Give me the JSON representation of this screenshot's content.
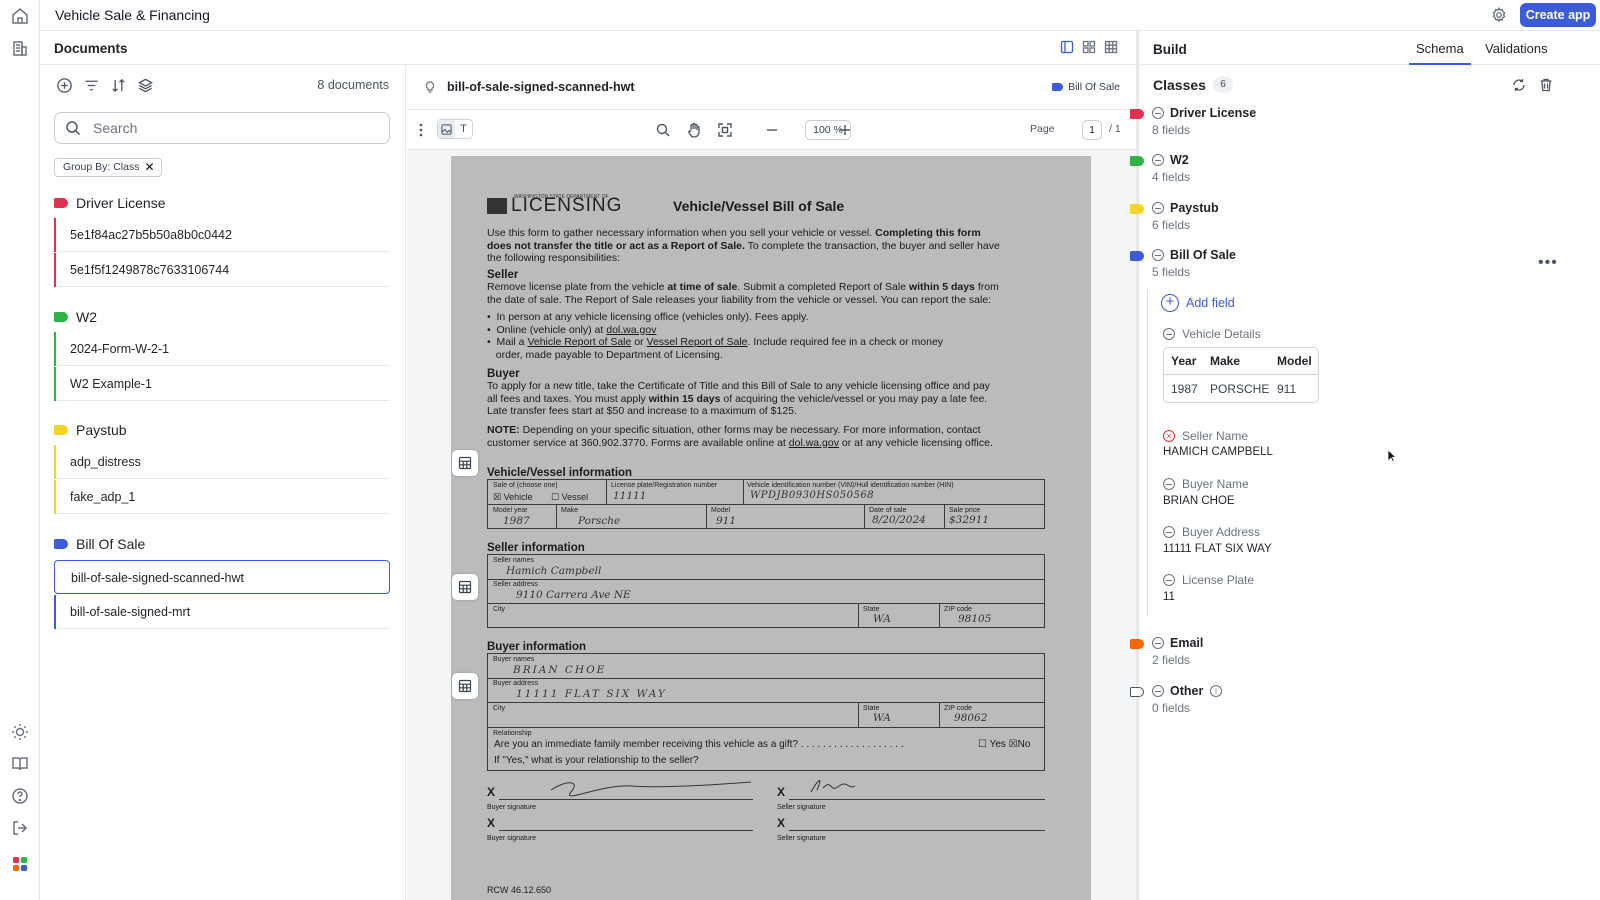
{
  "app": {
    "title": "Vehicle Sale & Financing",
    "create_app_label": "Create app"
  },
  "documents": {
    "title": "Documents",
    "count_label": "8 documents",
    "search_placeholder": "Search",
    "group_chip": "Group By: Class",
    "groups": [
      {
        "label": "Driver License",
        "color": "#e03150",
        "items": [
          "5e1f84ac27b5b50a8b0c0442",
          "5e1f5f1249878c7633106744"
        ]
      },
      {
        "label": "W2",
        "color": "#2fb344",
        "items": [
          "2024-Form-W-2-1",
          "W2 Example-1"
        ]
      },
      {
        "label": "Paystub",
        "color": "#f5d32a",
        "items": [
          "adp_distress",
          "fake_adp_1"
        ]
      },
      {
        "label": "Bill Of Sale",
        "color": "#3b5bdb",
        "items": [
          "bill-of-sale-signed-scanned-hwt",
          "bill-of-sale-signed-mrt"
        ]
      }
    ],
    "selected_item": "bill-of-sale-signed-scanned-hwt"
  },
  "viewer": {
    "file_name": "bill-of-sale-signed-scanned-hwt",
    "class_label": "Bill Of Sale",
    "zoom": "100 %",
    "page_label": "Page",
    "page_current": "1",
    "page_total": "/ 1"
  },
  "paper": {
    "dept_small": "WASHINGTON STATE DEPARTMENT OF",
    "dept_big": "LICENSING",
    "title": "Vehicle/Vessel Bill of Sale",
    "intro_1": "Use this form to gather necessary information when you sell your vehicle or vessel.",
    "intro_bold_1": "Completing this form",
    "intro_bold_2": "does not transfer the title or act as a Report of Sale.",
    "intro_2": "To complete the transaction, the buyer and seller have",
    "intro_3": "the following responsibilities:",
    "seller_head": "Seller",
    "seller_1a": "Remove license plate from the vehicle",
    "seller_1b": "at time of sale",
    "seller_1c": ". Submit a completed Report of Sale",
    "seller_1d": "within 5 days",
    "seller_1e": "from",
    "seller_2": "the date of sale. The Report of Sale releases your liability from the vehicle or vessel. You can report the sale:",
    "bullet_1": "In person at any vehicle licensing office (vehicles only). Fees apply.",
    "bullet_2a": "Online (vehicle only) at",
    "bullet_2b": "dol.wa.gov",
    "bullet_3a": "Mail a",
    "bullet_3b": "Vehicle Report of Sale",
    "bullet_3c": "or",
    "bullet_3d": "Vessel Report of Sale",
    "bullet_3e": ". Include required fee in a check or money",
    "bullet_3f": "order, made payable to Department of Licensing.",
    "buyer_head": "Buyer",
    "buyer_1": "To apply for a new title, take the Certificate of Title and this Bill of Sale to any vehicle licensing office and pay",
    "buyer_2a": "all fees and taxes. You must apply",
    "buyer_2b": "within 15 days",
    "buyer_2c": "of acquiring the vehicle/vessel or you may pay a late fee.",
    "buyer_3": "Late transfer fees start at $50 and increase to a maximum of $125.",
    "note_1a": "NOTE:",
    "note_1b": "Depending on your specific situation, other forms may be necessary. For more information, contact",
    "note_2a": "customer service at 360.902.3770. Forms are available online at",
    "note_2b": "dol.wa.gov",
    "note_2c": "or at any vehicle licensing office.",
    "vv_head": "Vehicle/Vessel information",
    "sale_of": "Sale of (choose one)",
    "opt_vehicle": "Vehicle",
    "opt_vessel": "Vessel",
    "plate_lbl": "License plate/Registration number",
    "vin_lbl": "Vehicle identification number (VIN)/Hull identification number (HIN)",
    "plate_val": "11111",
    "vin_val": "WPDJB0930HS050568",
    "model_year_lbl": "Model year",
    "make_lbl": "Make",
    "model_lbl": "Model",
    "date_lbl": "Date of sale",
    "price_lbl": "Sale price",
    "model_year_val": "1987",
    "make_val": "Porsche",
    "model_val": "911",
    "date_val": "8/20/2024",
    "price_val": "$32911",
    "seller_info_head": "Seller information",
    "seller_names_lbl": "Seller names",
    "seller_names_val": "Hamich Campbell",
    "seller_addr_lbl": "Seller address",
    "seller_addr_val": "9110 Carrera Ave NE",
    "city_lbl": "City",
    "state_lbl": "State",
    "zip_lbl": "ZIP code",
    "seller_state_val": "WA",
    "seller_zip_val": "98105",
    "buyer_info_head": "Buyer information",
    "buyer_names_lbl": "Buyer names",
    "buyer_names_val": "BRIAN CHOE",
    "buyer_addr_lbl": "Buyer address",
    "buyer_addr_val": "11111 FLAT SIX WAY",
    "buyer_state_val": "WA",
    "buyer_zip_val": "98062",
    "relationship_lbl": "Relationship",
    "family_q": "Are you an immediate family member receiving this vehicle as a gift? . . . . . . . . . . . . . . . . . . .",
    "yes_lbl": "Yes",
    "no_lbl": "No",
    "if_yes": "If \"Yes,\" what is your relationship to the seller?",
    "x_mark": "X",
    "buyer_sig": "Buyer signature",
    "seller_sig": "Seller signature",
    "footer_code": "RCW 46.12.650"
  },
  "build": {
    "title": "Build",
    "tabs": [
      "Schema",
      "Validations"
    ],
    "classes_label": "Classes",
    "classes_count": "6",
    "classes": [
      {
        "name": "Driver License",
        "sub": "8 fields",
        "color": "#e03150"
      },
      {
        "name": "W2",
        "sub": "4 fields",
        "color": "#2fb344"
      },
      {
        "name": "Paystub",
        "sub": "6 fields",
        "color": "#f5d32a"
      },
      {
        "name": "Bill Of Sale",
        "sub": "5 fields",
        "color": "#3b5bdb"
      },
      {
        "name": "Email",
        "sub": "2 fields",
        "color": "#f76707"
      },
      {
        "name": "Other",
        "sub": "0 fields",
        "color": "#ffffff"
      }
    ],
    "add_field": "Add field",
    "vehicle_details": {
      "label": "Vehicle Details",
      "columns": [
        "Year",
        "Make",
        "Model"
      ],
      "row": [
        "1987",
        "PORSCHE",
        "911"
      ]
    },
    "fields": [
      {
        "label": "Seller Name",
        "value": "HAMICH CAMPBELL"
      },
      {
        "label": "Buyer Name",
        "value": "BRIAN CHOE"
      },
      {
        "label": "Buyer Address",
        "value": "11111 FLAT SIX WAY"
      },
      {
        "label": "License Plate",
        "value": "11"
      }
    ]
  }
}
